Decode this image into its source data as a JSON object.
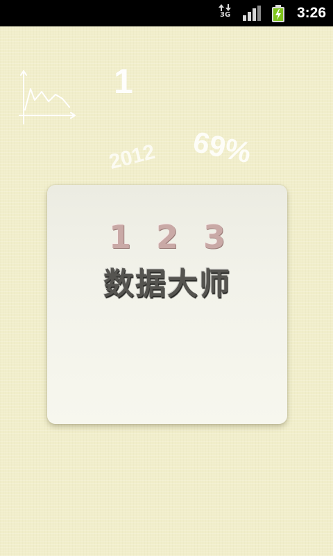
{
  "status_bar": {
    "network_type": "3G",
    "clock": "3:26",
    "icons": [
      "data-transfer-icon",
      "signal-strength-icon",
      "battery-charging-icon"
    ]
  },
  "background_decorations": {
    "number": "1",
    "year": "2012",
    "percent": "69%",
    "icon": "line-chart-icon"
  },
  "splash": {
    "number_logo": "1 2 3",
    "title": "数据大师"
  },
  "colors": {
    "background": "#f1eecb",
    "card": "#f2f2ea",
    "status_bar": "#000000",
    "battery_green": "#7fc41c",
    "logo_number": "#c9a9a6",
    "title_text": "#555450"
  }
}
